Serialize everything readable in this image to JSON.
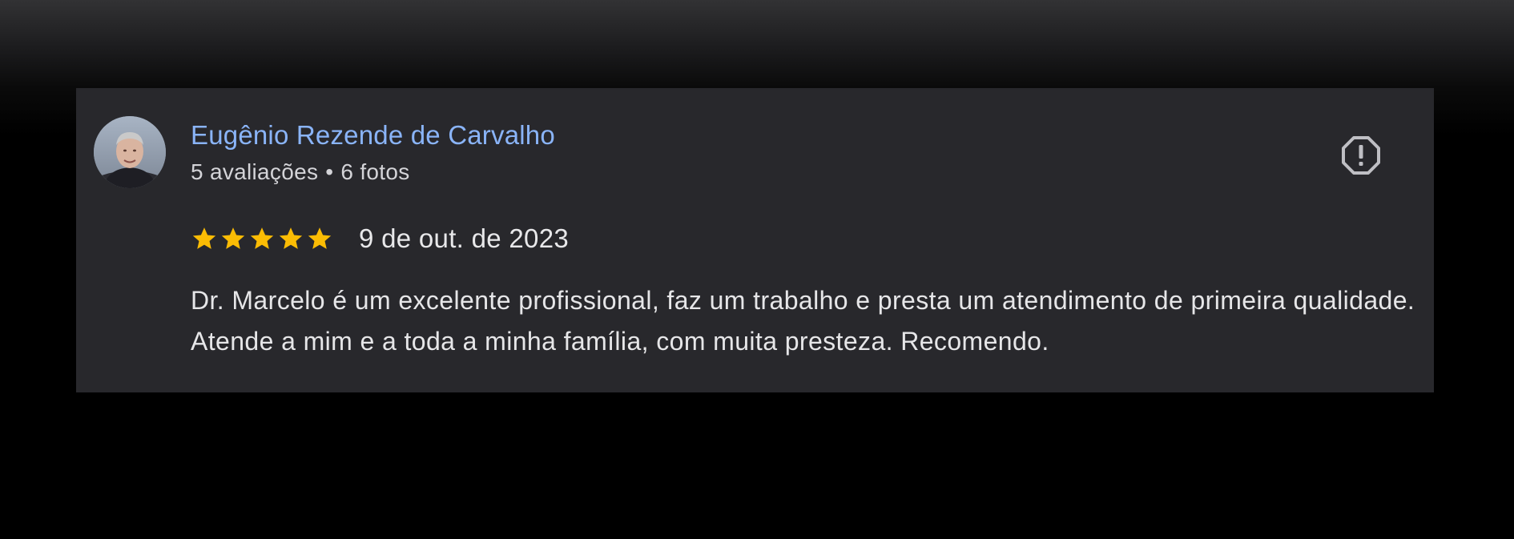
{
  "review": {
    "author": {
      "name": "Eugênio Rezende de Carvalho",
      "reviews_count": "5 avaliações",
      "separator": "•",
      "photos_count": "6 fotos"
    },
    "rating": 5,
    "rating_max": 5,
    "date": "9 de out. de 2023",
    "text": "Dr. Marcelo é um excelente profissional, faz um trabalho e presta um atendimento de primeira qualidade. Atende a mim e a toda a minha família, com muita presteza. Recomendo.",
    "flag_icon": "report-flag-icon"
  },
  "colors": {
    "card_background": "#28282c",
    "author_name": "#8ab4f8",
    "star": "#fbbc04",
    "text": "#e6e6e8"
  }
}
